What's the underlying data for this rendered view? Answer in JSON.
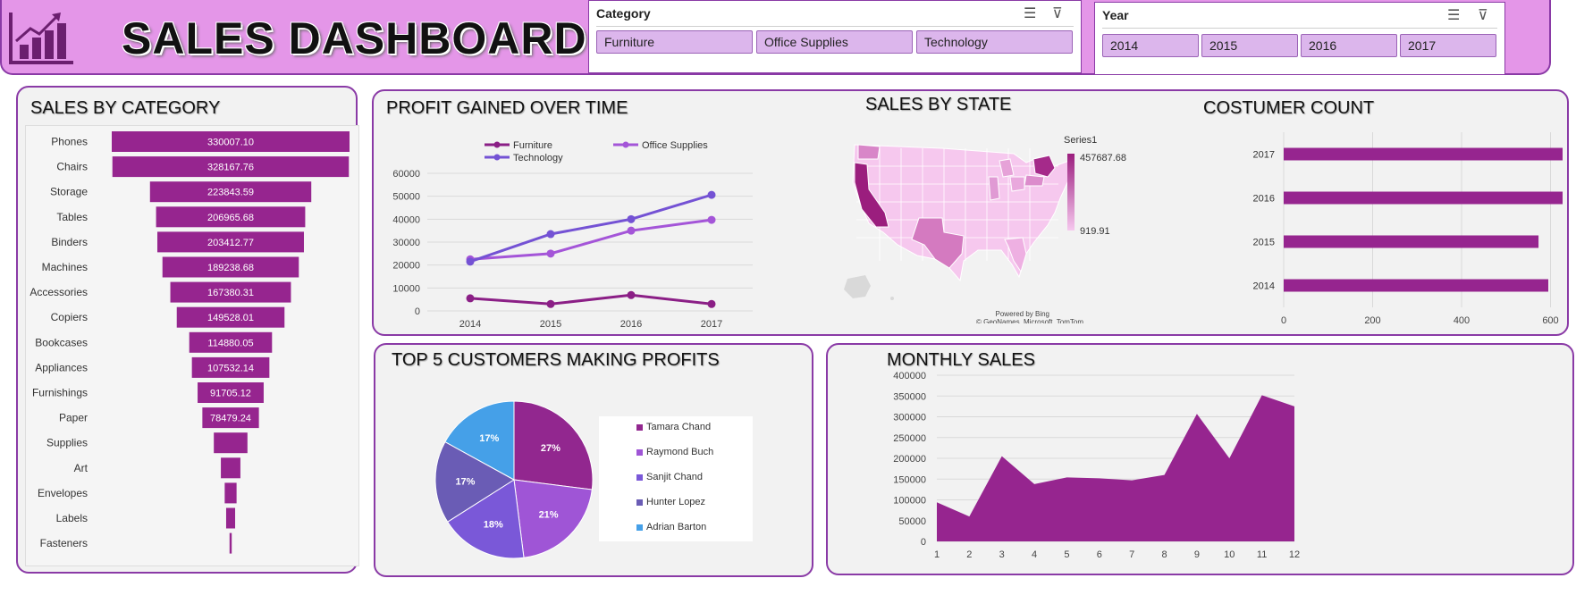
{
  "header": {
    "title": "SALES DASHBOARD",
    "icon": "bar-chart-growth-icon",
    "colors": {
      "background": "#e496e8",
      "accent": "#6b1f6f",
      "border": "#8a3aa6"
    }
  },
  "slicers": {
    "category": {
      "title": "Category",
      "items": [
        "Furniture",
        "Office Supplies",
        "Technology"
      ]
    },
    "year": {
      "title": "Year",
      "items": [
        "2014",
        "2015",
        "2016",
        "2017"
      ]
    },
    "icons": [
      "multi-select-icon",
      "clear-filter-icon"
    ]
  },
  "panels": {
    "sales_by_category": "SALES BY CATEGORY",
    "profit_over_time": "PROFIT GAINED OVER TIME",
    "sales_by_state": "SALES BY STATE",
    "customer_count": "COSTUMER COUNT",
    "top5_customers": "TOP 5 CUSTOMERS MAKING PROFITS",
    "monthly_sales": "MONTHLY SALES"
  },
  "map": {
    "legend_title": "Series1",
    "legend_max": "457687.68",
    "legend_min": "919.91",
    "credit_line1": "Powered by Bing",
    "credit_line2": "© GeoNames, Microsoft, TomTom",
    "colors": {
      "low": "#f6c8ee",
      "high": "#9b1e7e"
    }
  },
  "chart_data": [
    {
      "type": "bar",
      "name": "sales-by-category",
      "categories": [
        "Phones",
        "Chairs",
        "Storage",
        "Tables",
        "Binders",
        "Machines",
        "Accessories",
        "Copiers",
        "Bookcases",
        "Appliances",
        "Furnishings",
        "Paper",
        "Supplies",
        "Art",
        "Envelopes",
        "Labels",
        "Fasteners"
      ],
      "values": [
        330007.1,
        328167.76,
        223843.59,
        206965.68,
        203412.77,
        189238.68,
        167380.31,
        149528.01,
        114880.05,
        107532.14,
        91705.12,
        78479.24,
        46673.54,
        27118.79,
        16476.4,
        12486.31,
        3024.28
      ],
      "data_labels": [
        "330007.10",
        "328167.76",
        "223843.59",
        "206965.68",
        "203412.77",
        "189238.68",
        "167380.31",
        "149528.01",
        "114880.05",
        "107532.14",
        "91705.12",
        "78479.24",
        "",
        "",
        "",
        "",
        ""
      ],
      "color": "#96258f"
    },
    {
      "type": "line",
      "name": "profit-over-time",
      "x": [
        "2014",
        "2015",
        "2016",
        "2017"
      ],
      "series": [
        {
          "name": "Furniture",
          "values": [
            5500,
            3000,
            6900,
            3000
          ],
          "color": "#8b1f86"
        },
        {
          "name": "Office Supplies",
          "values": [
            22500,
            25000,
            35000,
            39700
          ],
          "color": "#a455d8"
        },
        {
          "name": "Technology",
          "values": [
            21500,
            33500,
            40000,
            50600
          ],
          "color": "#7452d4"
        }
      ],
      "ylim": [
        0,
        60000
      ],
      "yticks": [
        "0",
        "10000",
        "20000",
        "30000",
        "40000",
        "50000",
        "60000"
      ]
    },
    {
      "type": "bar",
      "name": "customer-count",
      "categories": [
        "2017",
        "2016",
        "2015",
        "2014"
      ],
      "values": [
        693,
        638,
        573,
        595
      ],
      "xlim": [
        0,
        800
      ],
      "xticks": [
        "0",
        "200",
        "400",
        "600",
        "800"
      ],
      "color": "#96258f"
    },
    {
      "type": "pie",
      "name": "top5-customers",
      "labels": [
        "Tamara Chand",
        "Raymond Buch",
        "Sanjit Chand",
        "Hunter Lopez",
        "Adrian Barton"
      ],
      "values": [
        27,
        21,
        18,
        17,
        17
      ],
      "data_labels": [
        "27%",
        "21%",
        "18%",
        "17%",
        "17%"
      ],
      "colors": [
        "#92278f",
        "#9f55d6",
        "#7a58d8",
        "#6a5cb5",
        "#45a0e8"
      ]
    },
    {
      "type": "area",
      "name": "monthly-sales",
      "x": [
        "1",
        "2",
        "3",
        "4",
        "5",
        "6",
        "7",
        "8",
        "9",
        "10",
        "11",
        "12"
      ],
      "values": [
        94000,
        60000,
        205000,
        138000,
        154000,
        152000,
        147000,
        160000,
        307000,
        200000,
        352000,
        325000
      ],
      "ylim": [
        0,
        400000
      ],
      "yticks": [
        "0",
        "50000",
        "100000",
        "150000",
        "200000",
        "250000",
        "300000",
        "350000",
        "400000"
      ],
      "color": "#96258f"
    }
  ]
}
